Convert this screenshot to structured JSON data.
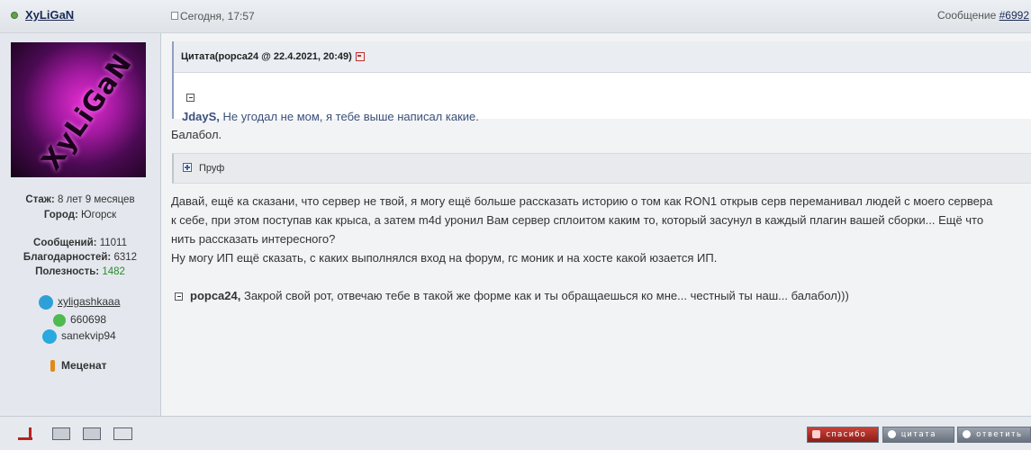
{
  "header": {
    "username": "XyLiGaN",
    "date": "Сегодня, 17:57",
    "message_label": "Сообщение ",
    "message_number": "#6992"
  },
  "profile": {
    "stazh_label": "Стаж:",
    "stazh_value": "8 лет 9 месяцев",
    "city_label": "Город:",
    "city_value": "Югорск",
    "posts_label": "Сообщений:",
    "posts_value": "11011",
    "thanks_label": "Благодарностей:",
    "thanks_value": "6312",
    "usefulness_label": "Полезность:",
    "usefulness_value": "1482",
    "telegram": "xyligashkaaa",
    "icq": "660698",
    "skype": "sanekvip94",
    "rank": "Меценат"
  },
  "quote": {
    "header": "Цитата(popca24 @ 22.4.2021, 20:49)",
    "author": "JdayS,",
    "text": " Не угодал не мом, я тебе выше написал какие."
  },
  "post": {
    "line1": "Балабол.",
    "spoiler_label": "Пруф",
    "p1": "Давай, ещё ка сказани, что сервер не твой, я могу ещё больше рассказать историю о том как RON1 открыв серв переманивал людей с моего сервера",
    "p2": "к себе, при этом поступав как крыса, а затем m4d уронил Вам сервер сплоитом каким то, который засунул в каждый плагин вашей сборки... Ещё что",
    "p3": "нить рассказать интересного?",
    "p4": "Ну могу ИП ещё сказать, с каких выполнялся вход на форум, гс моник и на хосте какой юзается ИП.",
    "reply_author": "popca24,",
    "reply_text": " Закрой свой рот, отвечаю тебе в такой же форме как и ты обращаешься ко мне... честный ты наш... балабол)))"
  },
  "footer": {
    "thanks_btn": "спасибо",
    "quote_btn": "цитата",
    "reply_btn": "ответить"
  },
  "colors": {
    "online": "#5fa34a",
    "usefulness": "#2a8a2a",
    "thanks_button": "#b8231b"
  },
  "icons": [
    "online-dot-icon",
    "post-icon",
    "telegram-icon",
    "icq-icon",
    "skype-icon",
    "medal-icon",
    "back-icon",
    "jump-icon",
    "plus-icon",
    "top-icon",
    "report-icon",
    "print-icon",
    "mail-icon"
  ]
}
